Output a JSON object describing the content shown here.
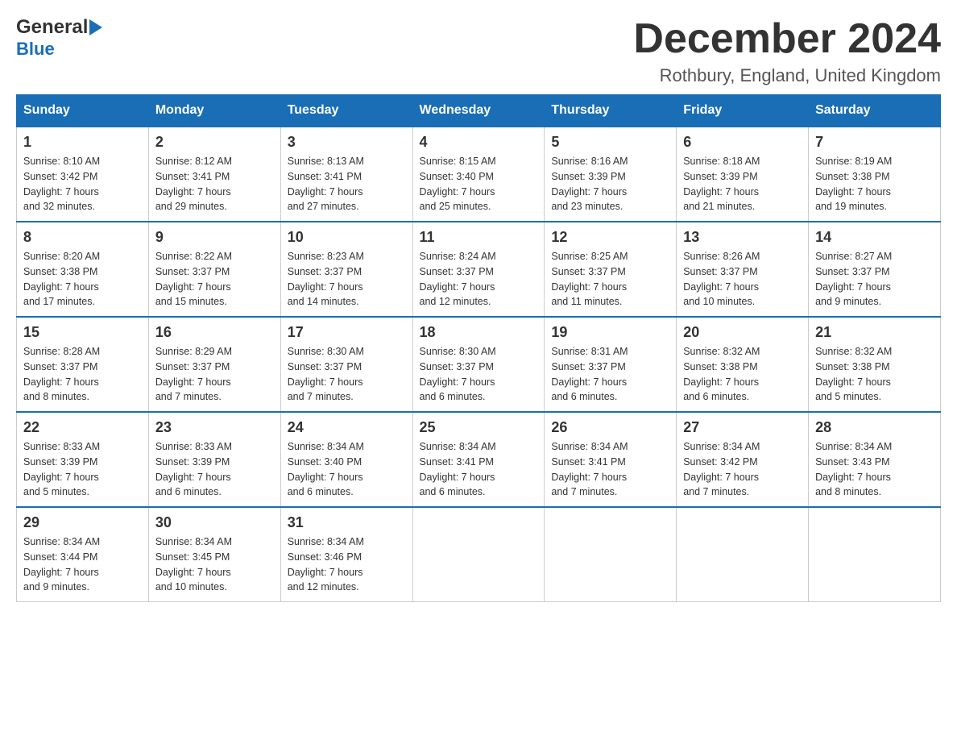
{
  "header": {
    "logo": {
      "general": "General",
      "blue": "Blue",
      "arrow_color": "#1a6eb5"
    },
    "title": "December 2024",
    "location": "Rothbury, England, United Kingdom"
  },
  "calendar": {
    "days_of_week": [
      "Sunday",
      "Monday",
      "Tuesday",
      "Wednesday",
      "Thursday",
      "Friday",
      "Saturday"
    ],
    "weeks": [
      [
        {
          "day": "1",
          "sunrise": "Sunrise: 8:10 AM",
          "sunset": "Sunset: 3:42 PM",
          "daylight": "Daylight: 7 hours",
          "minutes": "and 32 minutes."
        },
        {
          "day": "2",
          "sunrise": "Sunrise: 8:12 AM",
          "sunset": "Sunset: 3:41 PM",
          "daylight": "Daylight: 7 hours",
          "minutes": "and 29 minutes."
        },
        {
          "day": "3",
          "sunrise": "Sunrise: 8:13 AM",
          "sunset": "Sunset: 3:41 PM",
          "daylight": "Daylight: 7 hours",
          "minutes": "and 27 minutes."
        },
        {
          "day": "4",
          "sunrise": "Sunrise: 8:15 AM",
          "sunset": "Sunset: 3:40 PM",
          "daylight": "Daylight: 7 hours",
          "minutes": "and 25 minutes."
        },
        {
          "day": "5",
          "sunrise": "Sunrise: 8:16 AM",
          "sunset": "Sunset: 3:39 PM",
          "daylight": "Daylight: 7 hours",
          "minutes": "and 23 minutes."
        },
        {
          "day": "6",
          "sunrise": "Sunrise: 8:18 AM",
          "sunset": "Sunset: 3:39 PM",
          "daylight": "Daylight: 7 hours",
          "minutes": "and 21 minutes."
        },
        {
          "day": "7",
          "sunrise": "Sunrise: 8:19 AM",
          "sunset": "Sunset: 3:38 PM",
          "daylight": "Daylight: 7 hours",
          "minutes": "and 19 minutes."
        }
      ],
      [
        {
          "day": "8",
          "sunrise": "Sunrise: 8:20 AM",
          "sunset": "Sunset: 3:38 PM",
          "daylight": "Daylight: 7 hours",
          "minutes": "and 17 minutes."
        },
        {
          "day": "9",
          "sunrise": "Sunrise: 8:22 AM",
          "sunset": "Sunset: 3:37 PM",
          "daylight": "Daylight: 7 hours",
          "minutes": "and 15 minutes."
        },
        {
          "day": "10",
          "sunrise": "Sunrise: 8:23 AM",
          "sunset": "Sunset: 3:37 PM",
          "daylight": "Daylight: 7 hours",
          "minutes": "and 14 minutes."
        },
        {
          "day": "11",
          "sunrise": "Sunrise: 8:24 AM",
          "sunset": "Sunset: 3:37 PM",
          "daylight": "Daylight: 7 hours",
          "minutes": "and 12 minutes."
        },
        {
          "day": "12",
          "sunrise": "Sunrise: 8:25 AM",
          "sunset": "Sunset: 3:37 PM",
          "daylight": "Daylight: 7 hours",
          "minutes": "and 11 minutes."
        },
        {
          "day": "13",
          "sunrise": "Sunrise: 8:26 AM",
          "sunset": "Sunset: 3:37 PM",
          "daylight": "Daylight: 7 hours",
          "minutes": "and 10 minutes."
        },
        {
          "day": "14",
          "sunrise": "Sunrise: 8:27 AM",
          "sunset": "Sunset: 3:37 PM",
          "daylight": "Daylight: 7 hours",
          "minutes": "and 9 minutes."
        }
      ],
      [
        {
          "day": "15",
          "sunrise": "Sunrise: 8:28 AM",
          "sunset": "Sunset: 3:37 PM",
          "daylight": "Daylight: 7 hours",
          "minutes": "and 8 minutes."
        },
        {
          "day": "16",
          "sunrise": "Sunrise: 8:29 AM",
          "sunset": "Sunset: 3:37 PM",
          "daylight": "Daylight: 7 hours",
          "minutes": "and 7 minutes."
        },
        {
          "day": "17",
          "sunrise": "Sunrise: 8:30 AM",
          "sunset": "Sunset: 3:37 PM",
          "daylight": "Daylight: 7 hours",
          "minutes": "and 7 minutes."
        },
        {
          "day": "18",
          "sunrise": "Sunrise: 8:30 AM",
          "sunset": "Sunset: 3:37 PM",
          "daylight": "Daylight: 7 hours",
          "minutes": "and 6 minutes."
        },
        {
          "day": "19",
          "sunrise": "Sunrise: 8:31 AM",
          "sunset": "Sunset: 3:37 PM",
          "daylight": "Daylight: 7 hours",
          "minutes": "and 6 minutes."
        },
        {
          "day": "20",
          "sunrise": "Sunrise: 8:32 AM",
          "sunset": "Sunset: 3:38 PM",
          "daylight": "Daylight: 7 hours",
          "minutes": "and 6 minutes."
        },
        {
          "day": "21",
          "sunrise": "Sunrise: 8:32 AM",
          "sunset": "Sunset: 3:38 PM",
          "daylight": "Daylight: 7 hours",
          "minutes": "and 5 minutes."
        }
      ],
      [
        {
          "day": "22",
          "sunrise": "Sunrise: 8:33 AM",
          "sunset": "Sunset: 3:39 PM",
          "daylight": "Daylight: 7 hours",
          "minutes": "and 5 minutes."
        },
        {
          "day": "23",
          "sunrise": "Sunrise: 8:33 AM",
          "sunset": "Sunset: 3:39 PM",
          "daylight": "Daylight: 7 hours",
          "minutes": "and 6 minutes."
        },
        {
          "day": "24",
          "sunrise": "Sunrise: 8:34 AM",
          "sunset": "Sunset: 3:40 PM",
          "daylight": "Daylight: 7 hours",
          "minutes": "and 6 minutes."
        },
        {
          "day": "25",
          "sunrise": "Sunrise: 8:34 AM",
          "sunset": "Sunset: 3:41 PM",
          "daylight": "Daylight: 7 hours",
          "minutes": "and 6 minutes."
        },
        {
          "day": "26",
          "sunrise": "Sunrise: 8:34 AM",
          "sunset": "Sunset: 3:41 PM",
          "daylight": "Daylight: 7 hours",
          "minutes": "and 7 minutes."
        },
        {
          "day": "27",
          "sunrise": "Sunrise: 8:34 AM",
          "sunset": "Sunset: 3:42 PM",
          "daylight": "Daylight: 7 hours",
          "minutes": "and 7 minutes."
        },
        {
          "day": "28",
          "sunrise": "Sunrise: 8:34 AM",
          "sunset": "Sunset: 3:43 PM",
          "daylight": "Daylight: 7 hours",
          "minutes": "and 8 minutes."
        }
      ],
      [
        {
          "day": "29",
          "sunrise": "Sunrise: 8:34 AM",
          "sunset": "Sunset: 3:44 PM",
          "daylight": "Daylight: 7 hours",
          "minutes": "and 9 minutes."
        },
        {
          "day": "30",
          "sunrise": "Sunrise: 8:34 AM",
          "sunset": "Sunset: 3:45 PM",
          "daylight": "Daylight: 7 hours",
          "minutes": "and 10 minutes."
        },
        {
          "day": "31",
          "sunrise": "Sunrise: 8:34 AM",
          "sunset": "Sunset: 3:46 PM",
          "daylight": "Daylight: 7 hours",
          "minutes": "and 12 minutes."
        },
        null,
        null,
        null,
        null
      ]
    ]
  }
}
